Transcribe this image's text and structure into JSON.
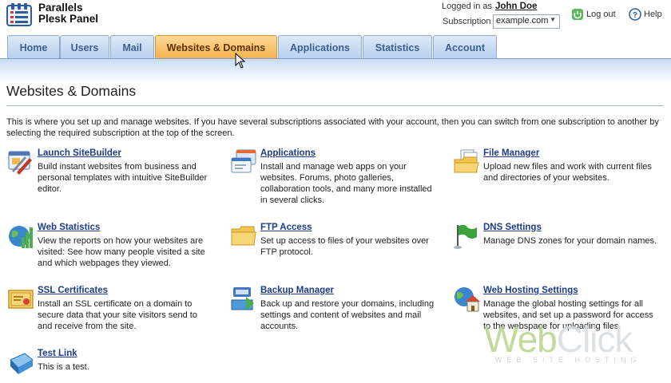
{
  "app": {
    "name_line1": "Parallels",
    "name_line2": "Plesk Panel"
  },
  "header": {
    "logged_in_label": "Logged in as",
    "user_name": "John Doe",
    "subscription_label": "Subscription",
    "subscription_value": "example.com",
    "logout_label": "Log out",
    "help_label": "Help"
  },
  "tabs": [
    {
      "label": "Home",
      "active": false
    },
    {
      "label": "Users",
      "active": false
    },
    {
      "label": "Mail",
      "active": false
    },
    {
      "label": "Websites & Domains",
      "active": true
    },
    {
      "label": "Applications",
      "active": false
    },
    {
      "label": "Statistics",
      "active": false
    },
    {
      "label": "Account",
      "active": false
    }
  ],
  "page": {
    "title": "Websites & Domains",
    "intro": "This is where you set up and manage websites. If you have several subscriptions associated with your account, then you can switch from one subscription to another by selecting the required subscription at the top of the screen."
  },
  "items": [
    {
      "icon": "sitebuilder-icon",
      "title": "Launch SiteBuilder",
      "desc": "Build instant websites from business and personal templates with intuitive SiteBuilder editor."
    },
    {
      "icon": "applications-icon",
      "title": "Applications",
      "desc": "Install and manage web apps on your websites. Forums, photo galleries, collaboration tools, and many more installed in several clicks."
    },
    {
      "icon": "file-manager-icon",
      "title": "File Manager",
      "desc": "Upload new files and work with current files and directories of your websites."
    },
    {
      "icon": "web-statistics-icon",
      "title": "Web Statistics",
      "desc": "View the reports on how your websites are visited: See how many people visited a site and which webpages they viewed."
    },
    {
      "icon": "ftp-folder-icon",
      "title": "FTP Access",
      "desc": "Set up access to files of your websites over FTP protocol."
    },
    {
      "icon": "dns-flag-icon",
      "title": "DNS Settings",
      "desc": "Manage DNS zones for your domain names."
    },
    {
      "icon": "ssl-certificate-icon",
      "title": "SSL Certificates",
      "desc": "Install an SSL certificate on a domain to secure data that your site visitors send to and receive from the site."
    },
    {
      "icon": "backup-icon",
      "title": "Backup Manager",
      "desc": "Back up and restore your domains, including settings and content of websites and mail accounts."
    },
    {
      "icon": "globe-house-icon",
      "title": "Web Hosting Settings",
      "desc": "Manage the global hosting settings for all websites, and set up a password for access to the webspace for uploading files."
    },
    {
      "icon": "test-link-icon",
      "title": "Test Link",
      "desc": "This is a test."
    }
  ],
  "watermark": {
    "word1": "Web",
    "word2": "Click",
    "tagline": "WEB SITE HOSTING"
  },
  "colors": {
    "accent_tab": "#f5b04c",
    "tab_blue": "#b7cfee",
    "link": "#1d3c8c"
  }
}
